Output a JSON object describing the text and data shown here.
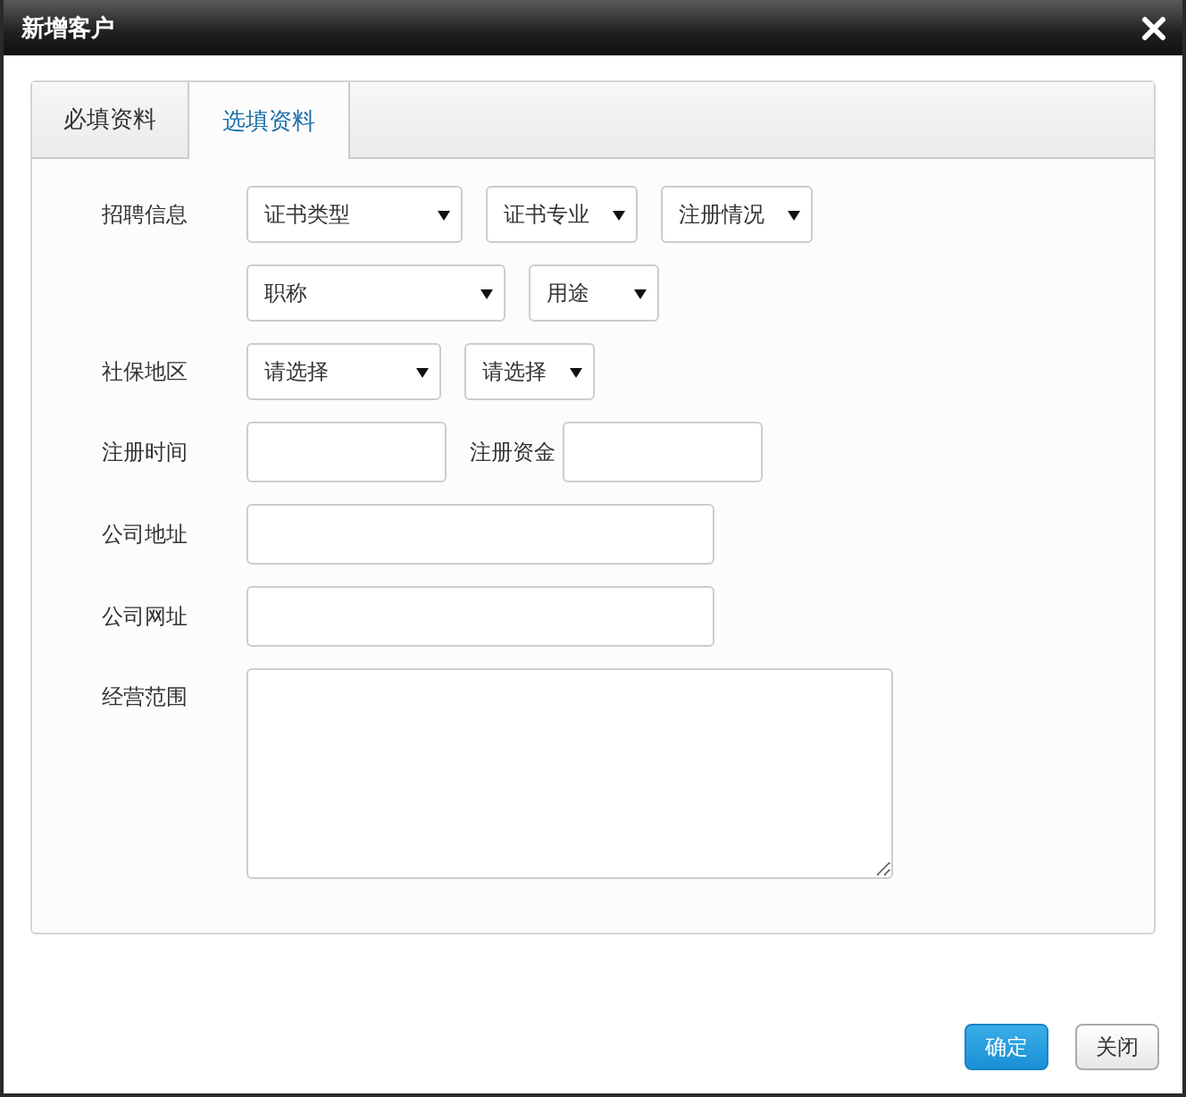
{
  "window": {
    "title": "新增客户"
  },
  "tabs": [
    {
      "label": "必填资料",
      "selected": false
    },
    {
      "label": "选填资料",
      "selected": true
    }
  ],
  "form": {
    "rows": [
      {
        "label": "招聘信息",
        "fields": [
          {
            "kind": "select",
            "value": "证书类型"
          },
          {
            "kind": "select",
            "value": "证书专业"
          },
          {
            "kind": "select",
            "value": "注册情况"
          }
        ]
      },
      {
        "fields": [
          {
            "kind": "select",
            "value": "职称"
          },
          {
            "kind": "select",
            "value": "用途"
          }
        ]
      },
      {
        "label": "社保地区",
        "fields": [
          {
            "kind": "select",
            "value": "请选择"
          },
          {
            "kind": "select",
            "value": "请选择"
          }
        ]
      },
      {
        "label": "注册时间",
        "fields": [
          {
            "kind": "input"
          },
          {
            "kind": "label",
            "text": "注册资金"
          },
          {
            "kind": "input"
          }
        ]
      },
      {
        "label": "公司地址",
        "fields": [
          {
            "kind": "input"
          }
        ]
      },
      {
        "label": "公司网址",
        "fields": [
          {
            "kind": "input"
          }
        ]
      },
      {
        "label": "经营范围",
        "fields": [
          {
            "kind": "textarea"
          }
        ]
      }
    ]
  },
  "buttons": [
    {
      "label": "确定",
      "kind": "primary"
    },
    {
      "label": "关闭",
      "kind": "default"
    }
  ]
}
